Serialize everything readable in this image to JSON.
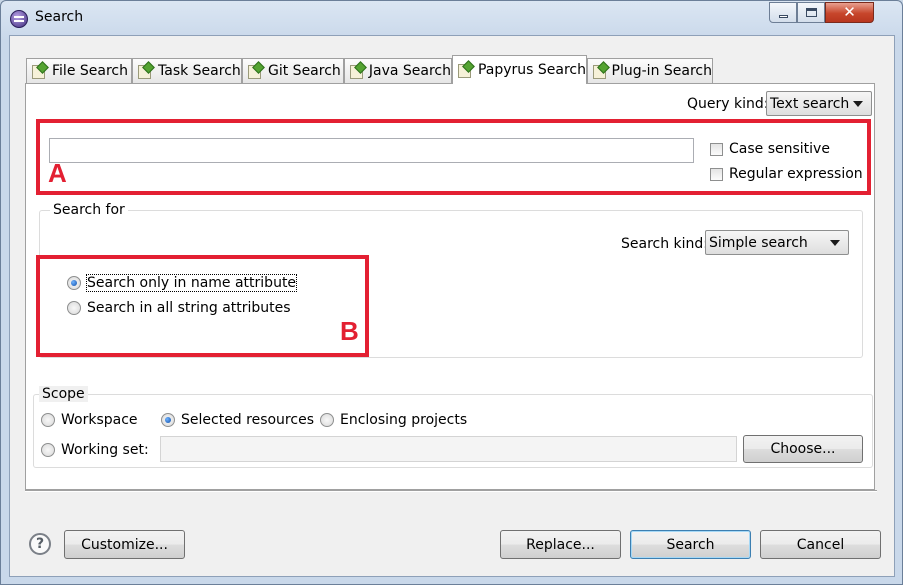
{
  "window": {
    "title": "Search"
  },
  "tabs": [
    {
      "label": "File Search"
    },
    {
      "label": "Task Search"
    },
    {
      "label": "Git Search"
    },
    {
      "label": "Java Search"
    },
    {
      "label": "Papyrus Search"
    },
    {
      "label": "Plug-in Search"
    }
  ],
  "query": {
    "kind_label": "Query kind:",
    "kind_value": "Text search",
    "text_value": "",
    "case_sensitive_label": "Case sensitive",
    "regex_label": "Regular expression"
  },
  "search_for": {
    "title": "Search for",
    "kind_label": "Search kind:",
    "kind_value": "Simple search",
    "option_name": "Search only in name attribute",
    "option_all": "Search in all string attributes"
  },
  "annotations": {
    "a": "A",
    "b": "B",
    "color": "#e32032"
  },
  "scope": {
    "title": "Scope",
    "workspace": "Workspace",
    "selected": "Selected resources",
    "enclosing": "Enclosing projects",
    "working_set": "Working set:",
    "choose": "Choose..."
  },
  "buttons": {
    "customize": "Customize...",
    "replace": "Replace...",
    "search": "Search",
    "cancel": "Cancel",
    "help": "?"
  },
  "colors": {
    "accent": "#3c7fb1",
    "close": "#c7462b"
  }
}
